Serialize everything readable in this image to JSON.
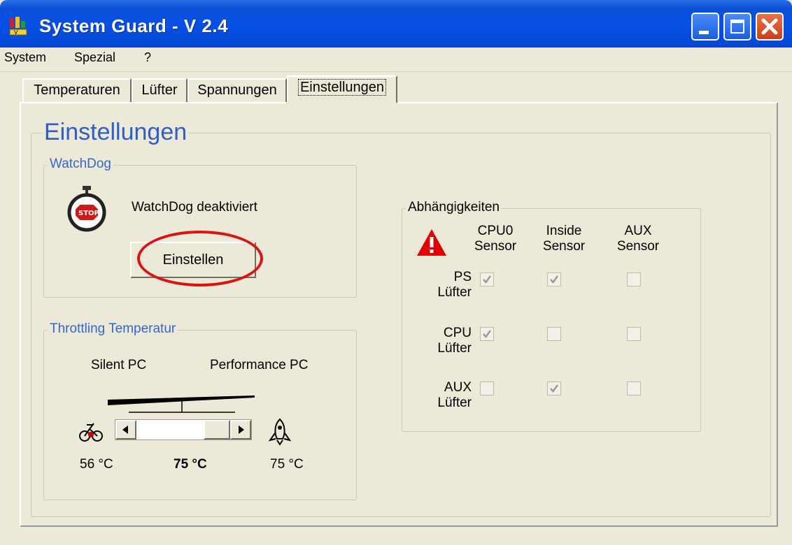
{
  "window": {
    "title": "System Guard - V 2.4",
    "title_bar_color": "#0650E6",
    "close_color": "#E0541F"
  },
  "menu": [
    "System",
    "Spezial",
    "?"
  ],
  "tabs": [
    {
      "label": "Temperaturen",
      "active": false
    },
    {
      "label": "Lüfter",
      "active": false
    },
    {
      "label": "Spannungen",
      "active": false
    },
    {
      "label": "Einstellungen",
      "active": true
    }
  ],
  "settings": {
    "title": "Einstellungen",
    "watchdog": {
      "legend": "WatchDog",
      "status": "WatchDog deaktiviert",
      "button_label": "Einstellen",
      "icon": "stopwatch-stop-icon"
    },
    "throttling": {
      "legend": "Throttling Temperatur",
      "left_label": "Silent PC",
      "right_label": "Performance PC",
      "min_temp": "56 °C",
      "current_temp": "75 °C",
      "max_temp": "75 °C",
      "slider_position": 1.0,
      "left_icon": "bicycle-icon",
      "right_icon": "rocket-icon"
    },
    "dependencies": {
      "legend": "Abhängigkeiten",
      "icon": "warning-icon",
      "columns": [
        {
          "line1": "CPU0",
          "line2": "Sensor"
        },
        {
          "line1": "Inside",
          "line2": "Sensor"
        },
        {
          "line1": "AUX",
          "line2": "Sensor"
        }
      ],
      "rows": [
        {
          "line1": "PS",
          "line2": "Lüfter",
          "checked": [
            true,
            true,
            false
          ]
        },
        {
          "line1": "CPU",
          "line2": "Lüfter",
          "checked": [
            true,
            false,
            false
          ]
        },
        {
          "line1": "AUX",
          "line2": "Lüfter",
          "checked": [
            false,
            true,
            false
          ]
        }
      ]
    }
  },
  "accent_colors": {
    "header_blue": "#2D5FC4",
    "highlight_red": "#DD1212",
    "warning_red": "#E00000"
  }
}
